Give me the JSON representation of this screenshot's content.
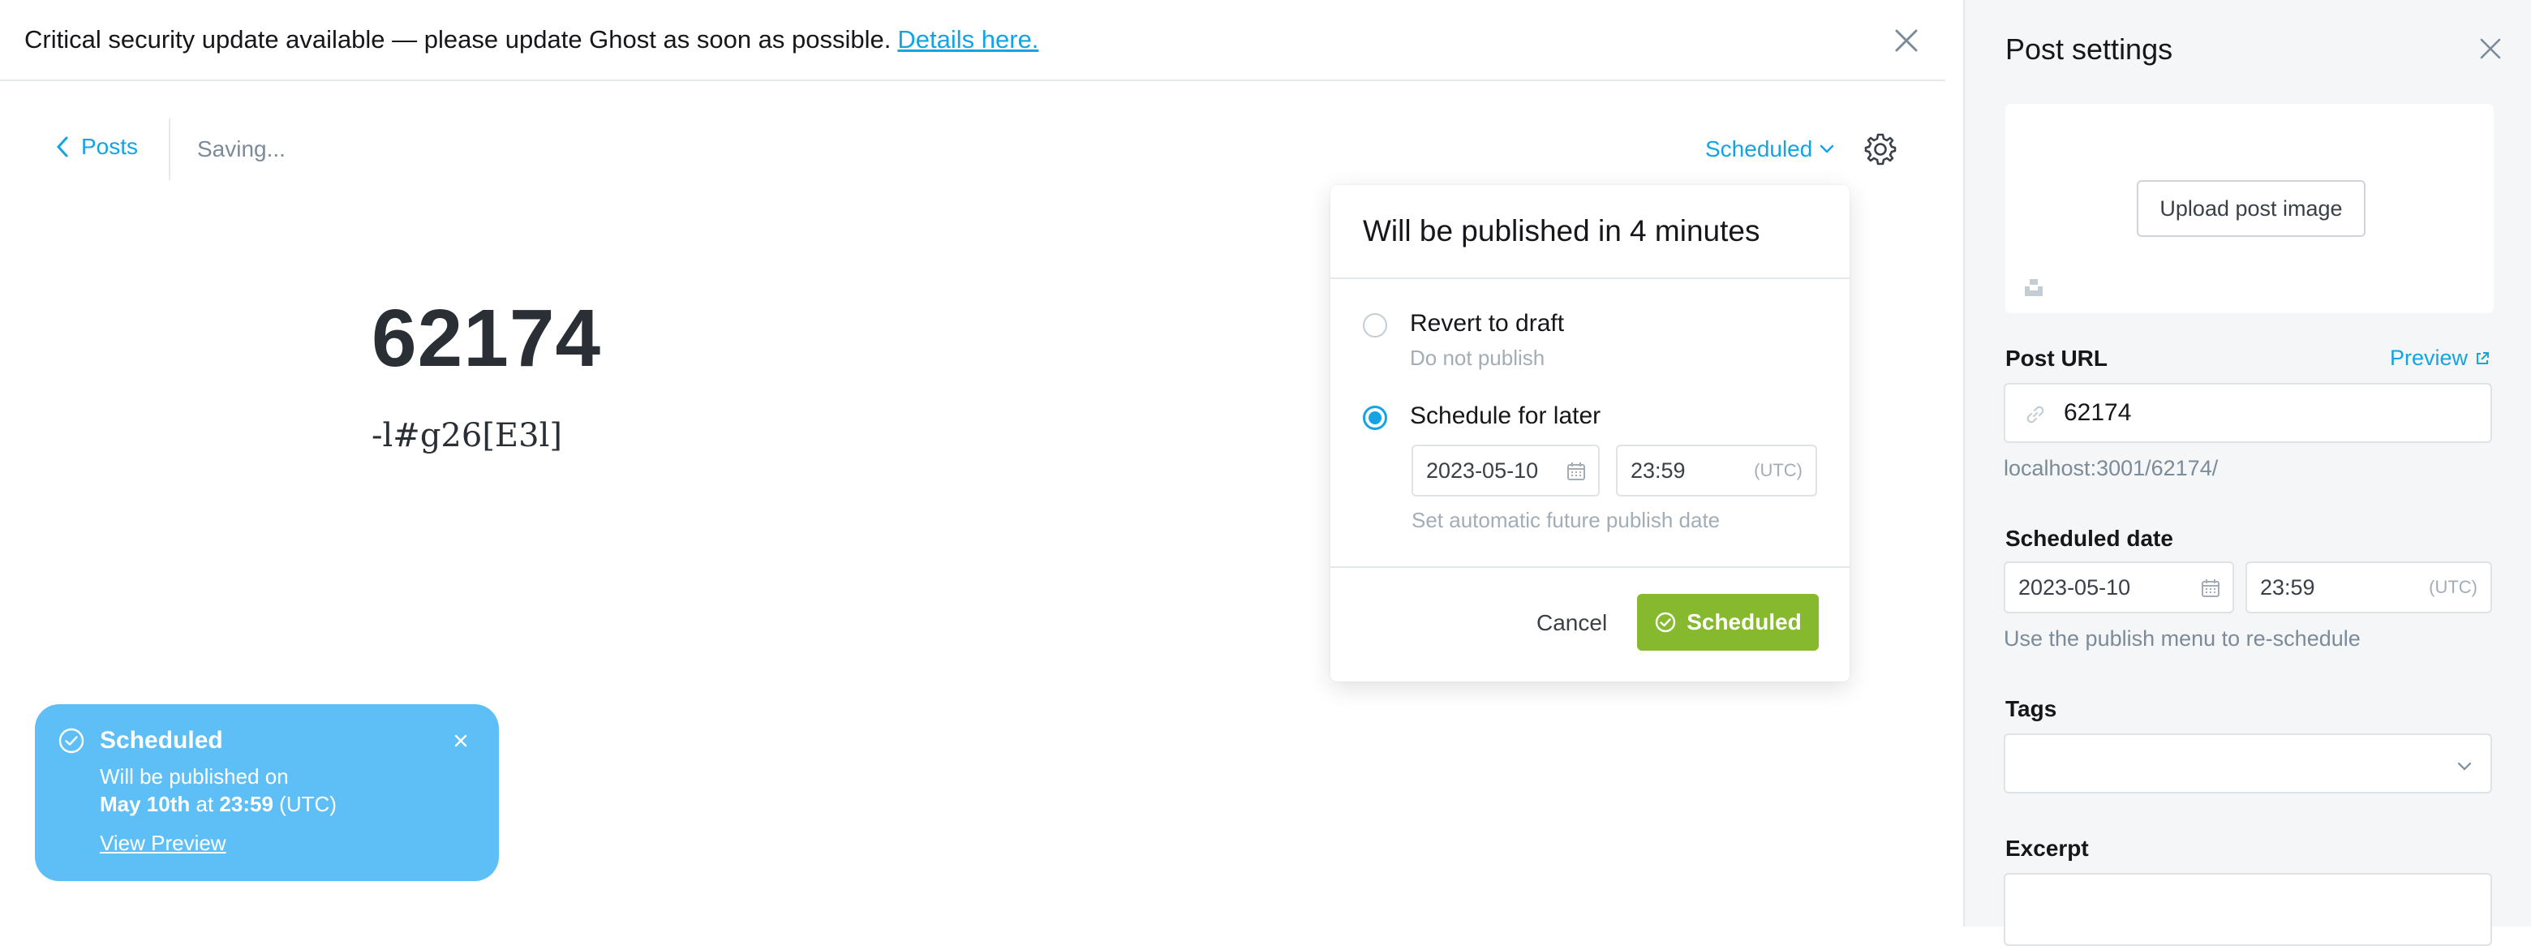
{
  "banner": {
    "message": "Critical security update available — please update Ghost as soon as possible.",
    "link_text": "Details here."
  },
  "topbar": {
    "back_label": "Posts",
    "saving_text": "Saving...",
    "status_label": "Scheduled"
  },
  "post": {
    "title": "62174",
    "body": "-l#g26[E3l]"
  },
  "publish_menu": {
    "heading": "Will be published in 4 minutes",
    "options": [
      {
        "title": "Revert to draft",
        "subtitle": "Do not publish",
        "selected": false
      },
      {
        "title": "Schedule for later",
        "subtitle": "Set automatic future publish date",
        "selected": true
      }
    ],
    "date_value": "2023-05-10",
    "time_value": "23:59",
    "timezone": "(UTC)",
    "cancel_label": "Cancel",
    "confirm_label": "Scheduled"
  },
  "toast": {
    "title": "Scheduled",
    "line1": "Will be published on",
    "date_bold": "May 10th",
    "at_word": "at",
    "time_bold": "23:59",
    "timezone": "(UTC)",
    "link_text": "View Preview"
  },
  "settings": {
    "title": "Post settings",
    "upload_label": "Upload post image",
    "post_url_label": "Post URL",
    "preview_label": "Preview",
    "slug": "62174",
    "url_hint": "localhost:3001/62174/",
    "scheduled_date_label": "Scheduled date",
    "date_value": "2023-05-10",
    "time_value": "23:59",
    "timezone": "(UTC)",
    "reschedule_hint": "Use the publish menu to re-schedule",
    "tags_label": "Tags",
    "excerpt_label": "Excerpt"
  },
  "colors": {
    "accent_blue": "#14a4e4",
    "toast_blue": "#5ebff7",
    "publish_green": "#86b92e",
    "panel_bg": "#f4f6f7"
  }
}
